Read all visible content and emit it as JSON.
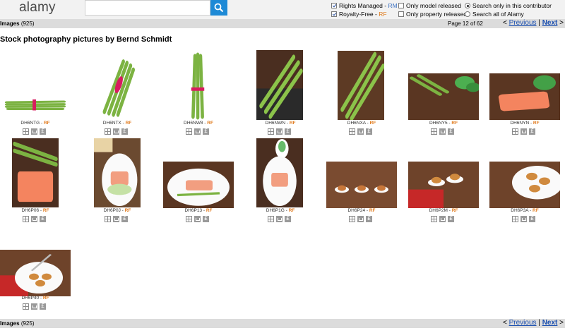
{
  "header": {
    "logo": "alamy",
    "search": {
      "value": "",
      "placeholder": ""
    },
    "options": {
      "rights_managed": "Rights Managed - ",
      "rm": "RM",
      "royalty_free": "Royalty-Free - ",
      "rf": "RF",
      "model_released": "Only model released",
      "property_released": "Only property released",
      "search_contributor": "Search only in this contributor",
      "search_all": "Search all of Alamy"
    }
  },
  "results": {
    "images_label": "Images",
    "count": "(925)",
    "page_info": "Page 12 of 62",
    "prev_arrow": "<",
    "previous": "Previous",
    "separator": "|",
    "next": "Next",
    "next_arrow": ">"
  },
  "page_title": "Stock photography pictures by Bernd Schmidt",
  "license_tag": "RF",
  "caption_sep": " - ",
  "thumbnails": [
    {
      "id": "DH6NTG",
      "scene": "asparagus-bundle-horizontal"
    },
    {
      "id": "DH6NTX",
      "scene": "asparagus-bundle-angled"
    },
    {
      "id": "DH6NW8",
      "scene": "asparagus-bundle-vertical"
    },
    {
      "id": "DH6NWN",
      "scene": "asparagus-on-slate"
    },
    {
      "id": "DH6NXA",
      "scene": "asparagus-on-wood"
    },
    {
      "id": "DH6NY5",
      "scene": "asparagus-herbs-wood"
    },
    {
      "id": "DH6NYN",
      "scene": "salmon-parsley"
    },
    {
      "id": "DH6P06",
      "scene": "asparagus-salmon"
    },
    {
      "id": "DH6P0J",
      "scene": "salmon-plate-bread"
    },
    {
      "id": "DH6P13",
      "scene": "salmon-plate"
    },
    {
      "id": "DH6P1G",
      "scene": "salmon-plate-salad"
    },
    {
      "id": "DH6P24",
      "scene": "spoons-wood"
    },
    {
      "id": "DH6P2M",
      "scene": "spoons-checkered"
    },
    {
      "id": "DH6P3A",
      "scene": "plate-appetizers"
    },
    {
      "id": "DH6P40",
      "scene": "plate-fork-checkered"
    }
  ],
  "colors": {
    "accent_blue": "#1e8ad6",
    "link_blue": "#1a4fb0",
    "rf_orange": "#e07a1c",
    "bar_grey": "#dcdcdc"
  }
}
